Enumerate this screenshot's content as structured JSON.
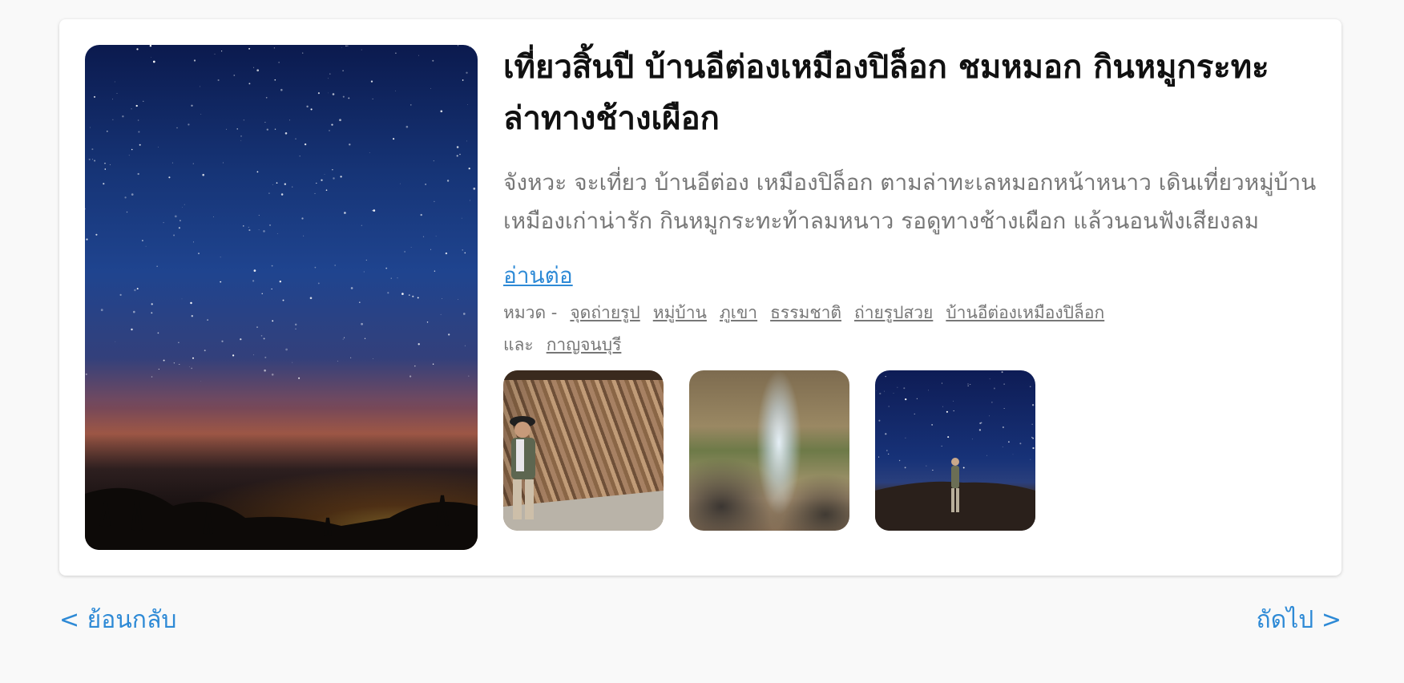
{
  "post": {
    "title": "เที่ยวสิ้นปี บ้านอีต่องเหมืองปิล็อก ชมหมอก กินหมูกระทะ ล่าทางช้างเผือก",
    "excerpt": "จังหวะ จะเที่ยว บ้านอีต่อง เหมืองปิล็อก ตามล่าทะเลหมอกหน้าหนาว เดินเที่ยวหมู่บ้านเหมืองเก่าน่ารัก กินหมูกระทะท้าลมหนาว รอดูทางช้างเผือก แล้วนอนฟังเสียงลม",
    "read_more": "อ่านต่อ",
    "category_prefix": "หมวด -",
    "categories": [
      "จุดถ่ายรูป",
      "หมู่บ้าน",
      "ภูเขา",
      "ธรรมชาติ",
      "ถ่ายรูปสวย",
      "บ้านอีต่องเหมืองปิล็อก"
    ],
    "and_label": "และ",
    "province": "กาญจนบุรี",
    "hero_image": "starry-night-sky-photo",
    "thumbnails": [
      "wooden-wish-tags-photo",
      "waterfall-photo",
      "stargazer-photo"
    ]
  },
  "pagination": {
    "prev": "< ย้อนกลับ",
    "next": "ถัดไป >"
  },
  "colors": {
    "link": "#2e8ad6",
    "muted": "#777777",
    "title": "#111111",
    "background": "#f9f9f9"
  }
}
